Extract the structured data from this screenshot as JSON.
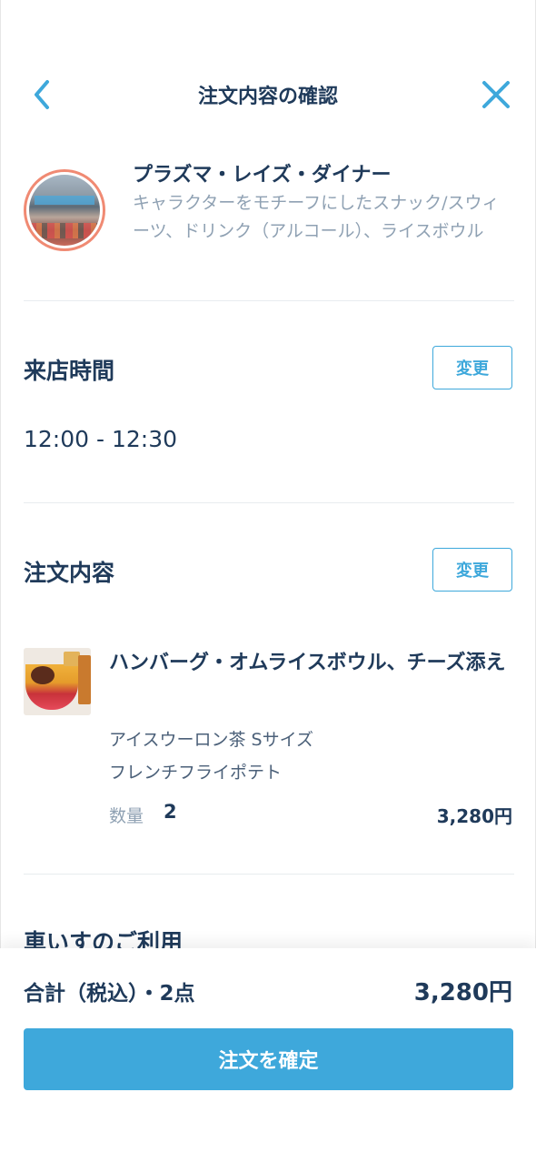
{
  "header": {
    "title": "注文内容の確認"
  },
  "restaurant": {
    "name": "プラズマ・レイズ・ダイナー",
    "description": "キャラクターをモチーフにしたスナック/スウィーツ、ドリンク（アルコール）、ライスボウル"
  },
  "visit": {
    "title": "来店時間",
    "change_label": "変更",
    "time": "12:00 - 12:30"
  },
  "order": {
    "title": "注文内容",
    "change_label": "変更",
    "item": {
      "name": "ハンバーグ・オムライスボウル、チーズ添え",
      "options": [
        "アイスウーロン茶 Sサイズ",
        "フレンチフライポテト"
      ],
      "quantity_label": "数量",
      "quantity": "2",
      "price": "3,280円"
    }
  },
  "next_section": {
    "title": "車いすのご利用"
  },
  "footer": {
    "total_label": "合計（税込）・2点",
    "total_price": "3,280円",
    "confirm_label": "注文を確定"
  },
  "colors": {
    "accent": "#3ea8db",
    "text": "#1f3a5a",
    "subtext": "#8fa1b3",
    "avatar_ring": "#f08a73"
  }
}
